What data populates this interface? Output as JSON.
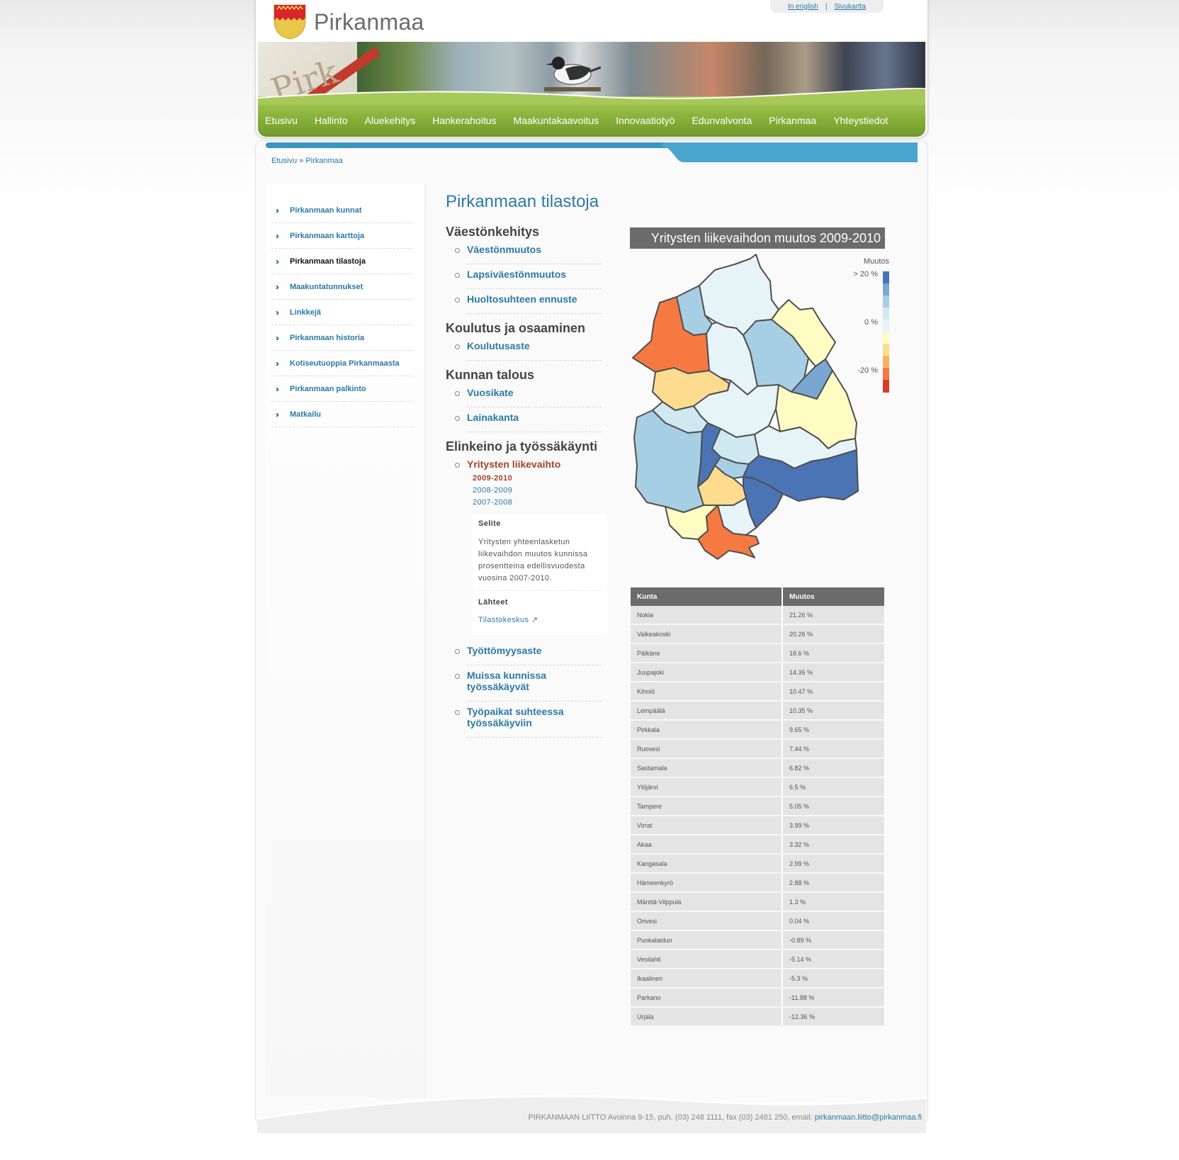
{
  "site": {
    "name": "Pirkanmaa",
    "toplinks": [
      "In english",
      "Sivukartta"
    ]
  },
  "nav": [
    "Etusivu",
    "Hallinto",
    "Aluekehitys",
    "Hankerahoitus",
    "Maakuntakaavoitus",
    "Innovaatiotyö",
    "Edunvalvonta",
    "Pirkanmaa",
    "Yhteystiedot"
  ],
  "breadcrumb": {
    "home": "Etusivu",
    "sep": "»",
    "current": "Pirkanmaa"
  },
  "sidebar": {
    "items": [
      {
        "label": "Pirkanmaan kunnat",
        "active": false
      },
      {
        "label": "Pirkanmaan karttoja",
        "active": false
      },
      {
        "label": "Pirkanmaan tilastoja",
        "active": true
      },
      {
        "label": "Maakuntatunnukset",
        "active": false
      },
      {
        "label": "Linkkejä",
        "active": false
      },
      {
        "label": "Pirkanmaan historia",
        "active": false
      },
      {
        "label": "Kotiseutuoppia Pirkanmaasta",
        "active": false
      },
      {
        "label": "Pirkanmaan palkinto",
        "active": false
      },
      {
        "label": "Matkailu",
        "active": false
      }
    ]
  },
  "main": {
    "title": "Pirkanmaan tilastoja",
    "sections": [
      {
        "heading": "Väestönkehitys",
        "items": [
          "Väestönmuutos",
          "Lapsiväestönmuutos",
          "Huoltosuhteen ennuste"
        ]
      },
      {
        "heading": "Koulutus ja osaaminen",
        "items": [
          "Koulutusaste"
        ]
      },
      {
        "heading": "Kunnan talous",
        "items": [
          "Vuosikate",
          "Lainakanta"
        ]
      },
      {
        "heading": "Elinkeino ja työssäkäynti",
        "current_item": "Yritysten liikevaihto",
        "items_after": [
          "Työttömyysaste",
          "Muissa kunnissa työssäkäyvät",
          "Työpaikat suhteessa työssäkäyviin"
        ]
      }
    ],
    "years": [
      {
        "label": "2009-2010",
        "current": true
      },
      {
        "label": "2008-2009",
        "current": false
      },
      {
        "label": "2007-2008",
        "current": false
      }
    ],
    "selite": {
      "heading": "Selite",
      "text": "Yritysten yhteenlasketun liikevaihdon muutos kunnissa prosentteina edellisvuodesta vuosina 2007-2010.",
      "sources_heading": "Lähteet",
      "source_link": "Tilastokeskus"
    }
  },
  "map": {
    "title": "Yritysten liikevaihdon muutos 2009-2010",
    "legend": {
      "title": "Muutos",
      "labels": [
        "> 20 %",
        "0 %",
        "-20 %"
      ],
      "colors": [
        "#4a74b4",
        "#7aa7d2",
        "#a6cfe3",
        "#d0e9f1",
        "#e6f4f8",
        "#fefbc3",
        "#fddc90",
        "#fcb062",
        "#f57a42",
        "#db3b2b"
      ]
    }
  },
  "table": {
    "headers": [
      "Kunta",
      "Muutos"
    ],
    "rows": [
      [
        "Nokia",
        "21.26 %"
      ],
      [
        "Valkeakoski",
        "20.26 %"
      ],
      [
        "Pälkäne",
        "18.6 %"
      ],
      [
        "Juupajoki",
        "14.36 %"
      ],
      [
        "Kihniö",
        "10.47 %"
      ],
      [
        "Lempäälä",
        "10.35 %"
      ],
      [
        "Pirkkala",
        "9.65 %"
      ],
      [
        "Ruovesi",
        "7.44 %"
      ],
      [
        "Sastamala",
        "6.82 %"
      ],
      [
        "Ylöjärvi",
        "6.5 %"
      ],
      [
        "Tampere",
        "5.05 %"
      ],
      [
        "Virrat",
        "3.99 %"
      ],
      [
        "Akaa",
        "3.32 %"
      ],
      [
        "Kangasala",
        "2.99 %"
      ],
      [
        "Hämeenkyrö",
        "2.88 %"
      ],
      [
        "Mänttä-Vilppula",
        "1.3 %"
      ],
      [
        "Orivesi",
        "0.04 %"
      ],
      [
        "Punkalaidun",
        "-0.89 %"
      ],
      [
        "Vesilahti",
        "-5.14 %"
      ],
      [
        "Ikaalinen",
        "-5.3 %"
      ],
      [
        "Parkano",
        "-11.88 %"
      ],
      [
        "Urjala",
        "-12.36 %"
      ]
    ]
  },
  "footer": {
    "text": "PIRKANMAAN LIITTO Avoinna 9-15, puh. (03) 248 1111, fax (03) 2481 250, email: ",
    "email": "pirkanmaan.liitto@pirkanmaa.fi"
  }
}
